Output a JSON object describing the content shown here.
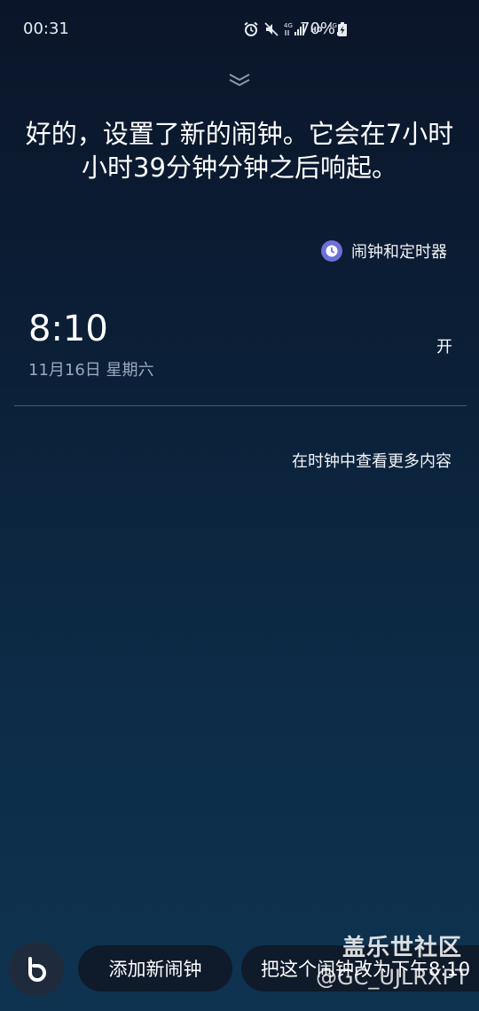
{
  "status_bar": {
    "time": "00:31",
    "battery": "70%",
    "icons": [
      "alarm-icon",
      "mute-icon",
      "4g-signal-icon",
      "hd-icon",
      "4g-signal-icon",
      "battery-charging-icon"
    ]
  },
  "response": {
    "text": "好的，设置了新的闹钟。它会在7小时小时39分钟分钟之后响起。"
  },
  "app_link": {
    "icon": "clock-icon",
    "label": "闹钟和定时器",
    "icon_color": "#6d70d8"
  },
  "alarm": {
    "time": "8:10",
    "date": "11月16日 星期六",
    "status": "开"
  },
  "more_link": {
    "label": "在时钟中查看更多内容"
  },
  "suggestions": [
    {
      "label": "添加新闹钟"
    },
    {
      "label": "把这个闹钟改为下午8:10"
    }
  ],
  "watermark": {
    "title": "盖乐世社区",
    "handle": "@GC_UJLRXPT"
  }
}
